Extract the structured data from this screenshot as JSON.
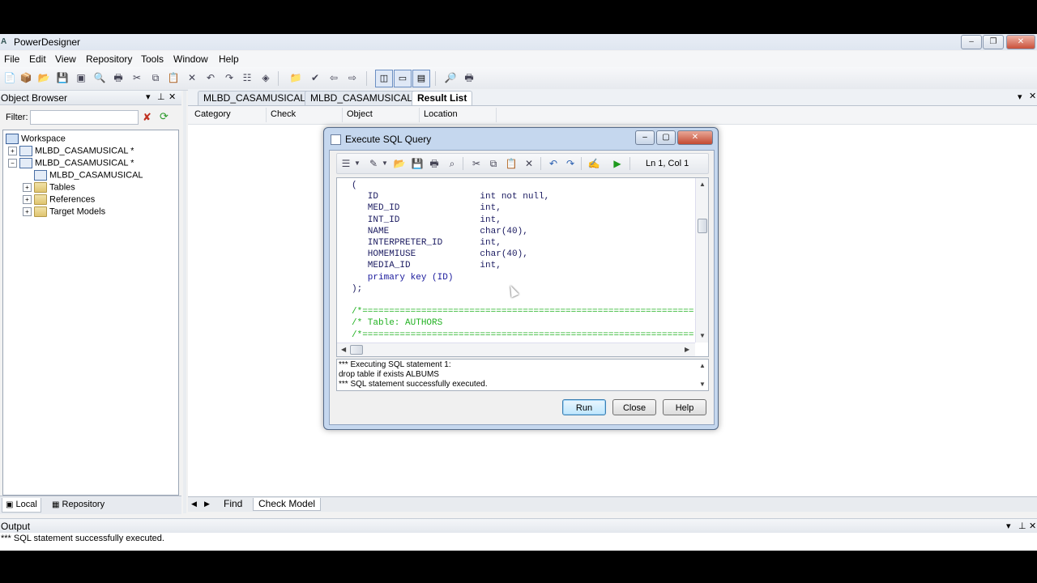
{
  "window": {
    "title": "PowerDesigner",
    "min": "‒",
    "restore": "❐",
    "close": "✕"
  },
  "menu": [
    "File",
    "Edit",
    "View",
    "Repository",
    "Tools",
    "Window",
    "Help"
  ],
  "object_browser": {
    "title": "Object Browser",
    "filter_label": "Filter:",
    "filter_value": "",
    "tree": {
      "workspace": "Workspace",
      "model1": "MLBD_CASAMUSICAL *",
      "model2": "MLBD_CASAMUSICAL *",
      "diagram": "MLBD_CASAMUSICAL",
      "tables": "Tables",
      "references": "References",
      "target_models": "Target Models"
    },
    "tabs": {
      "local": "Local",
      "repository": "Repository"
    }
  },
  "doc_tabs": [
    {
      "label": "MLBD_CASAMUSICAL"
    },
    {
      "label": "MLBD_CASAMUSICAL"
    },
    {
      "label": "Result List"
    }
  ],
  "result_list": {
    "columns": [
      "Category",
      "Check",
      "Object",
      "Location"
    ]
  },
  "bottom_tabs": {
    "find": "Find",
    "check_model": "Check Model"
  },
  "output": {
    "title": "Output",
    "line": "*** SQL statement successfully executed."
  },
  "dialog": {
    "title": "Execute SQL Query",
    "position": "Ln 1, Col 1",
    "code_lines": [
      "(",
      "   ID                   int not null,",
      "   MED_ID               int,",
      "   INT_ID               int,",
      "   NAME                 char(40),",
      "   INTERPRETER_ID       int,",
      "   HOMEMIUSE            char(40),",
      "   MEDIA_ID             int,",
      "   primary key (ID)",
      ");",
      "",
      "/*==============================================================*/",
      "/* Table: AUTHORS                                               */",
      "/*==============================================================*/"
    ],
    "messages": [
      "*** Executing SQL statement 1:",
      "drop table if exists ALBUMS",
      "*** SQL statement successfully executed."
    ],
    "buttons": {
      "run": "Run",
      "close": "Close",
      "help": "Help"
    }
  },
  "icons": {
    "filter_clear": "filter-clear-icon",
    "refresh": "refresh-icon",
    "run_toolbar": "run-icon"
  },
  "colors": {
    "comment": "#22b222",
    "keyword": "#1a1a9c",
    "accent": "#3c7fb1"
  }
}
